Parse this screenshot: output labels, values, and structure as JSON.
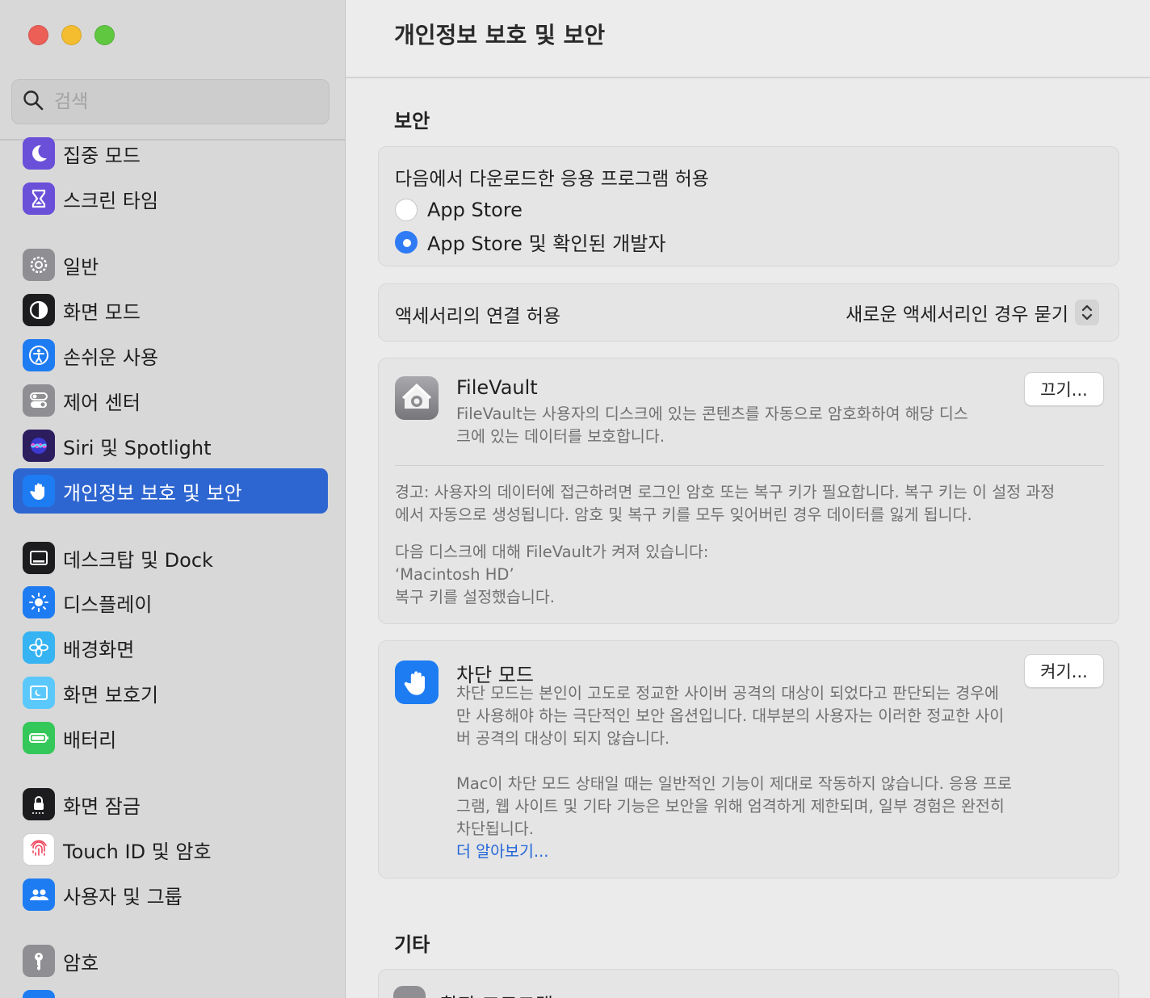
{
  "window": {
    "title": "개인정보 보호 및 보안"
  },
  "search": {
    "placeholder": "검색"
  },
  "sidebar": {
    "items": [
      {
        "label": "집중 모드",
        "icon": "moon-icon",
        "color": "#6a4fd9"
      },
      {
        "label": "스크린 타임",
        "icon": "hourglass-icon",
        "color": "#6a4fd9"
      },
      {
        "label": "일반",
        "icon": "gear-icon",
        "color": "#8e8e93"
      },
      {
        "label": "화면 모드",
        "icon": "appearance-icon",
        "color": "#1c1c1e"
      },
      {
        "label": "손쉬운 사용",
        "icon": "accessibility-icon",
        "color": "#1e7cf2"
      },
      {
        "label": "제어 센터",
        "icon": "toggles-icon",
        "color": "#8e8e93"
      },
      {
        "label": "Siri 및 Spotlight",
        "icon": "siri-icon",
        "color": "#2b1d5e"
      },
      {
        "label": "개인정보 보호 및 보안",
        "icon": "hand-icon",
        "color": "#1e7cf2",
        "active": true
      },
      {
        "label": "데스크탑 및 Dock",
        "icon": "dock-icon",
        "color": "#1c1c1e"
      },
      {
        "label": "디스플레이",
        "icon": "sun-icon",
        "color": "#1e7cf2"
      },
      {
        "label": "배경화면",
        "icon": "flower-icon",
        "color": "#35b3f2"
      },
      {
        "label": "화면 보호기",
        "icon": "screensaver-icon",
        "color": "#5ac8fa"
      },
      {
        "label": "배터리",
        "icon": "battery-icon",
        "color": "#34c759"
      },
      {
        "label": "화면 잠금",
        "icon": "lock-icon",
        "color": "#1c1c1e"
      },
      {
        "label": "Touch ID 및 암호",
        "icon": "fingerprint-icon",
        "color": "#ffffff"
      },
      {
        "label": "사용자 및 그룹",
        "icon": "users-icon",
        "color": "#1e7cf2"
      },
      {
        "label": "암호",
        "icon": "key-icon",
        "color": "#8e8e93"
      }
    ]
  },
  "security": {
    "section_title": "보안",
    "download": {
      "label": "다음에서 다운로드한 응용 프로그램 허용",
      "options": [
        {
          "label": "App Store",
          "selected": false
        },
        {
          "label": "App Store 및 확인된 개발자",
          "selected": true
        }
      ]
    },
    "accessory": {
      "label": "액세서리의 연결 허용",
      "value": "새로운 액세서리인 경우 묻기"
    },
    "filevault": {
      "title": "FileVault",
      "description": "FileVault는 사용자의 디스크에 있는 콘텐츠를 자동으로 암호화하여 해당 디스크에 있는 데이터를 보호합니다.",
      "button": "끄기...",
      "warning": "경고: 사용자의 데이터에 접근하려면 로그인 암호 또는 복구 키가 필요합니다. 복구 키는 이 설정 과정에서 자동으로 생성됩니다. 암호 및 복구 키를 모두 잊어버린 경우 데이터를 잃게 됩니다.",
      "status_line1": "다음 디스크에 대해 FileVault가 켜져 있습니다:",
      "status_line2": "‘Macintosh HD’",
      "status_line3": "복구 키를 설정했습니다."
    },
    "lockdown": {
      "title": "차단 모드",
      "description": "차단 모드는 본인이 고도로 정교한 사이버 공격의 대상이 되었다고 판단되는 경우에만 사용해야 하는 극단적인 보안 옵션입니다. 대부분의 사용자는 이러한 정교한 사이버 공격의 대상이 되지 않습니다.",
      "description2": "Mac이 차단 모드 상태일 때는 일반적인 기능이 제대로 작동하지 않습니다. 응용 프로그램, 웹 사이트 및 기타 기능은 보안을 위해 엄격하게 제한되며, 일부 경험은 완전히 차단됩니다.",
      "link": "더 알아보기...",
      "button": "켜기..."
    }
  },
  "other": {
    "section_title": "기타",
    "first_item": "확장 프로그램"
  },
  "colors": {
    "accent": "#2e66d1",
    "link": "#2466d8"
  }
}
